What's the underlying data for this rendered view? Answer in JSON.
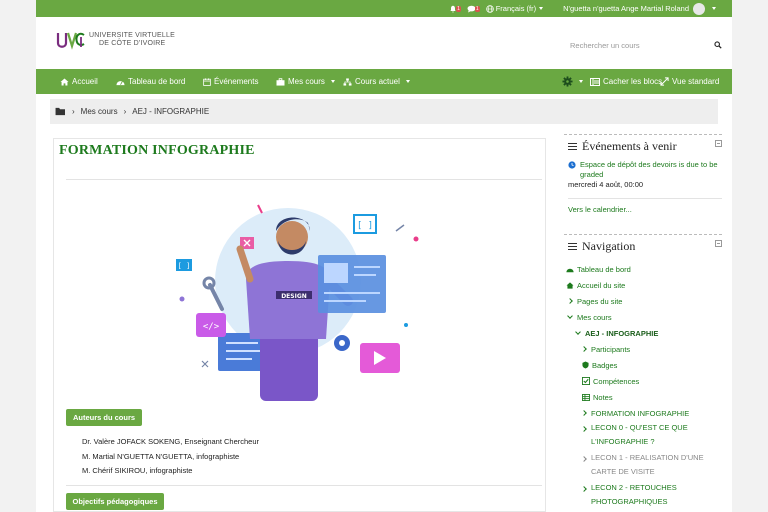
{
  "topbar": {
    "notif_count": "1",
    "msg_count": "1",
    "language": "Français (fr)",
    "user_name": "N'guetta n'guetta Ange Martial Roland"
  },
  "header": {
    "logo_line1": "UNIVERSITE VIRTUELLE",
    "logo_line2": "DE CÔTE D'IVOIRE",
    "search_placeholder": "Rechercher un cours"
  },
  "nav": {
    "items": [
      {
        "label": "Accueil",
        "icon": "home-icon"
      },
      {
        "label": "Tableau de bord",
        "icon": "dashboard-icon"
      },
      {
        "label": "Événements",
        "icon": "calendar-icon"
      },
      {
        "label": "Mes cours",
        "icon": "briefcase-icon"
      },
      {
        "label": "Cours actuel",
        "icon": "sitemap-icon"
      }
    ],
    "hide_blocks": "Cacher les blocs",
    "standard_view": "Vue standard"
  },
  "breadcrumb": {
    "items": [
      "Mes cours",
      "AEJ - INFOGRAPHIE"
    ]
  },
  "main": {
    "title": "FORMATION INFOGRAPHIE",
    "authors_button": "Auteurs du cours",
    "authors": [
      "Dr. Valère JOFACK SOKENG, Enseignant Chercheur",
      "M. Martial N'GUETTA N'GUETTA, infographiste",
      "M. Chérif SIKIROU, infographiste"
    ],
    "objectives_button": "Objectifs pédagogiques",
    "illustration_text": "DESIGN"
  },
  "events": {
    "title": "Événements à venir",
    "event_title": "Espace de dépôt des devoirs is due to be graded",
    "event_date": "mercredi 4 août, 00:00",
    "calendar_link": "Vers le calendrier..."
  },
  "navigation": {
    "title": "Navigation",
    "items": [
      "Tableau de bord",
      "Accueil du site",
      "Pages du site",
      "Mes cours",
      "AEJ - INFOGRAPHIE",
      "Participants",
      "Badges",
      "Compétences",
      "Notes",
      "FORMATION INFOGRAPHIE",
      "LECON 0 - QU'EST CE QUE L'INFOGRAPHIE ?",
      "LECON 1 - REALISATION D'UNE CARTE DE VISITE",
      "LECON 2 - RETOUCHES PHOTOGRAPHIQUES"
    ]
  },
  "colors": {
    "brand_green": "#6aa842",
    "link_green": "#1d7a1d"
  }
}
